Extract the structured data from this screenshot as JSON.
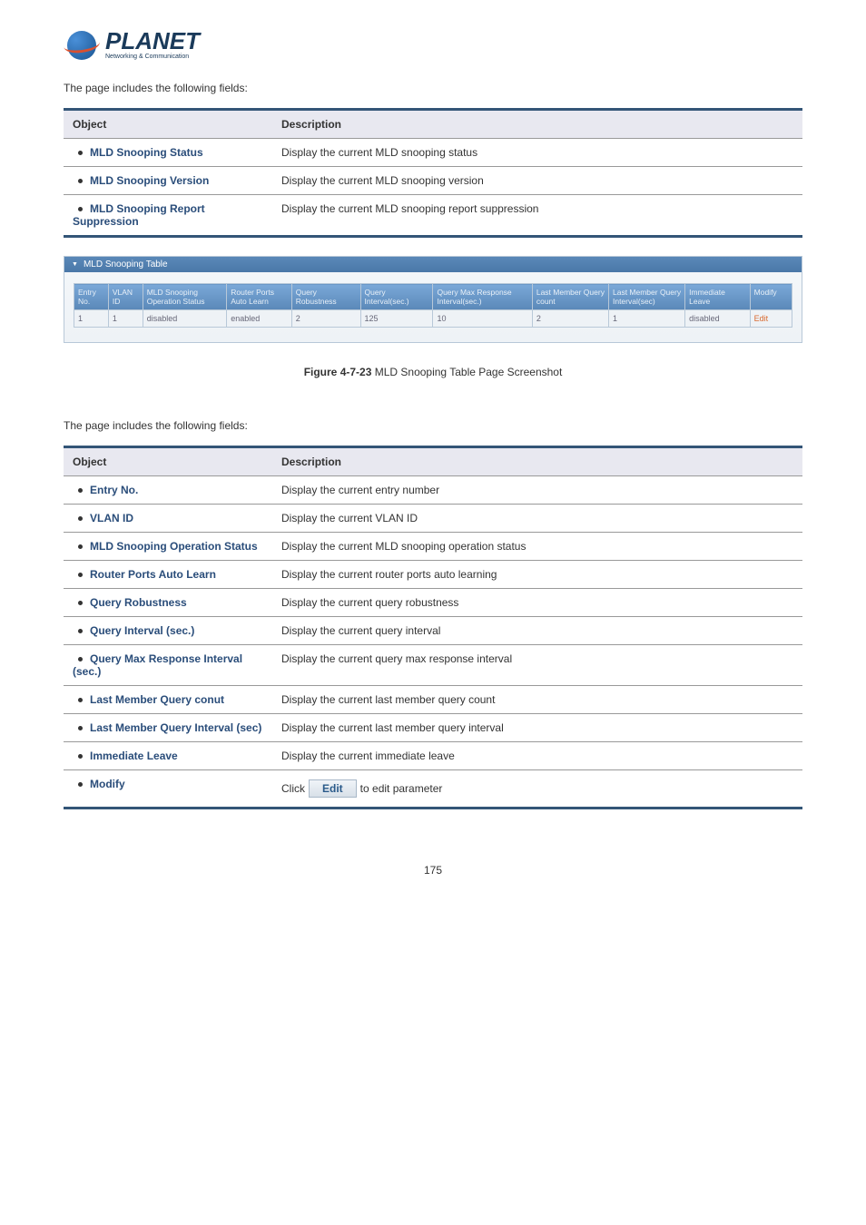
{
  "logo": {
    "name": "PLANET",
    "tagline": "Networking & Communication"
  },
  "intro1": "The page includes the following fields:",
  "table1": {
    "headers": [
      "Object",
      "Description"
    ],
    "rows": [
      {
        "object": "MLD Snooping Status",
        "desc": "Display the current MLD snooping status"
      },
      {
        "object": "MLD Snooping Version",
        "desc": "Display the current MLD snooping version"
      },
      {
        "object": "MLD Snooping Report Suppression",
        "desc": "Display the current MLD snooping report suppression"
      }
    ]
  },
  "mld_panel": {
    "title": "MLD Snooping Table",
    "headers": [
      "Entry No.",
      "VLAN ID",
      "MLD Snooping Operation Status",
      "Router Ports Auto Learn",
      "Query Robustness",
      "Query Interval(sec.)",
      "Query Max Response Interval(sec.)",
      "Last Member Query count",
      "Last Member Query Interval(sec)",
      "Immediate Leave",
      "Modify"
    ],
    "row": {
      "entry": "1",
      "vlan": "1",
      "op": "disabled",
      "router": "enabled",
      "robust": "2",
      "qint": "125",
      "qmax": "10",
      "lmqc": "2",
      "lmqi": "1",
      "leave": "disabled",
      "modify": "Edit"
    }
  },
  "figure": {
    "label": "Figure 4-7-23",
    "desc": " MLD Snooping Table Page Screenshot"
  },
  "intro2": "The page includes the following fields:",
  "table2": {
    "headers": [
      "Object",
      "Description"
    ],
    "rows": [
      {
        "object": "Entry No.",
        "desc": "Display the current entry number"
      },
      {
        "object": "VLAN ID",
        "desc": "Display the current VLAN ID"
      },
      {
        "object": "MLD Snooping Operation Status",
        "desc": "Display the current MLD snooping operation status"
      },
      {
        "object": "Router Ports Auto Learn",
        "desc": "Display the current router ports auto learning"
      },
      {
        "object": "Query Robustness",
        "desc": "Display the current query robustness"
      },
      {
        "object": "Query Interval (sec.)",
        "desc": "Display the current query interval"
      },
      {
        "object": "Query Max Response Interval (sec.)",
        "desc": "Display the current query max response interval"
      },
      {
        "object": "Last Member Query conut",
        "desc": "Display the current last member query count"
      },
      {
        "object": "Last Member Query Interval (sec)",
        "desc": "Display the current last member query interval"
      },
      {
        "object": "Immediate Leave",
        "desc": "Display the current immediate leave"
      },
      {
        "object": "Modify",
        "desc_pre": "Click ",
        "btn": "Edit",
        "desc_post": " to edit parameter"
      }
    ]
  },
  "page_num": "175"
}
